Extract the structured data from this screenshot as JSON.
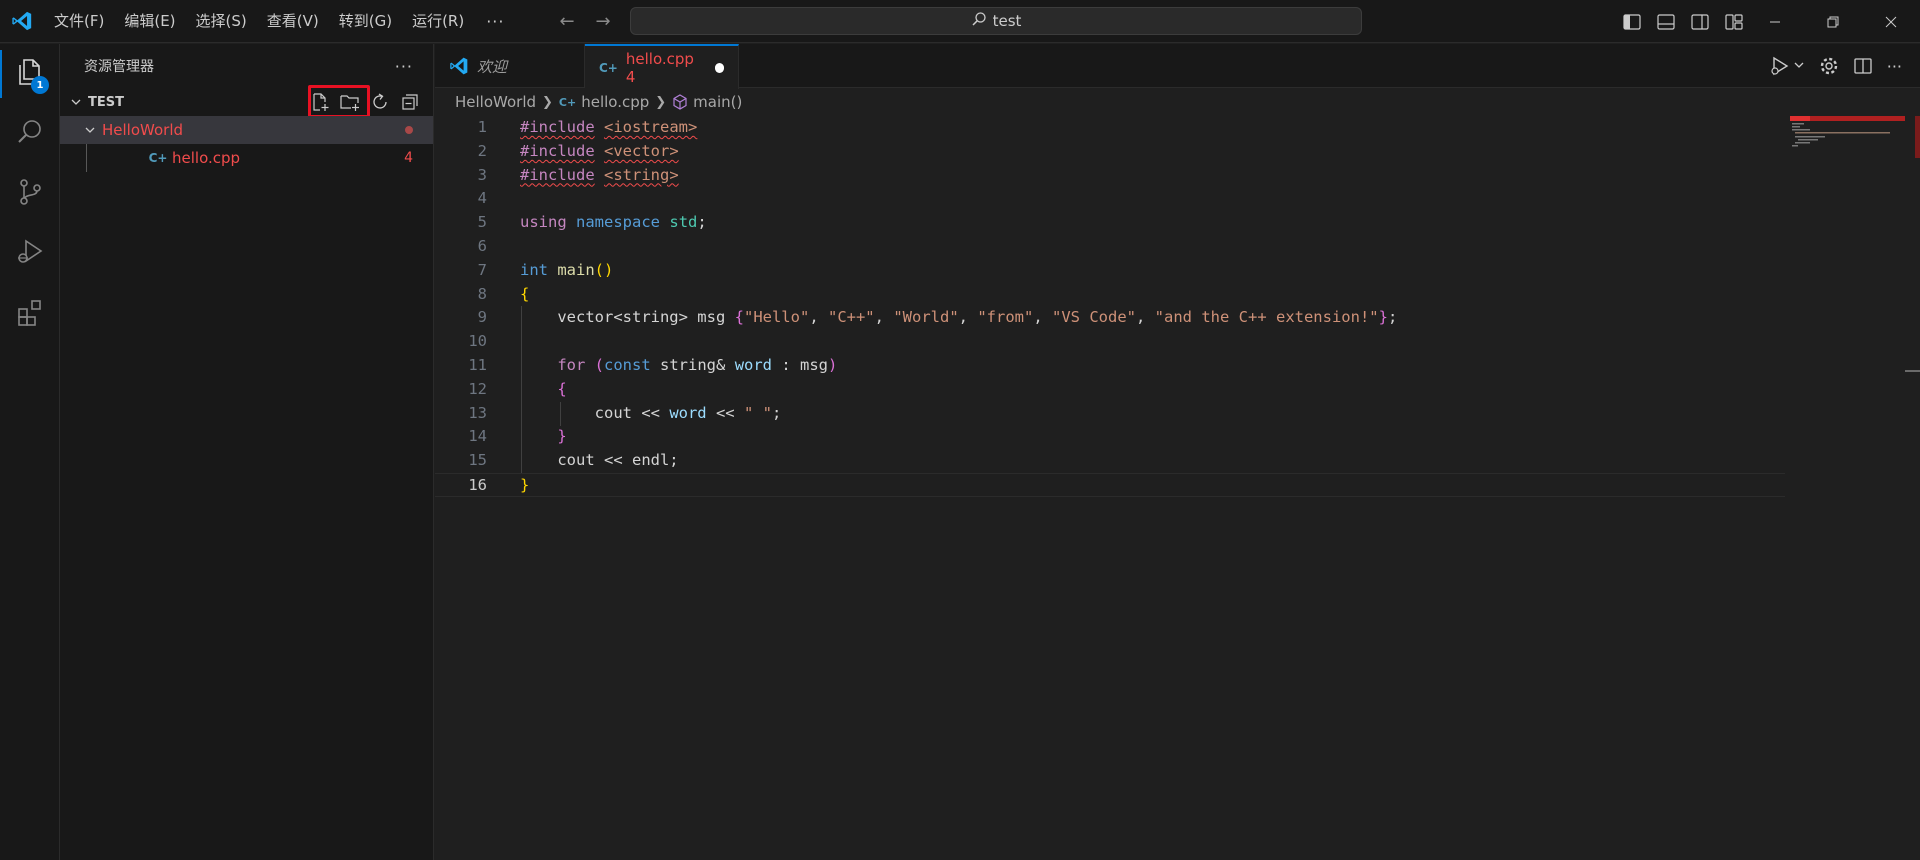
{
  "menu": [
    "文件(F)",
    "编辑(E)",
    "选择(S)",
    "查看(V)",
    "转到(G)",
    "运行(R)"
  ],
  "menu_more": "···",
  "search": {
    "text": "test"
  },
  "explorer": {
    "title": "资源管理器",
    "more": "···",
    "badge": "1",
    "section": "TEST",
    "folder": "HelloWorld",
    "file": "hello.cpp",
    "file_problems": "4",
    "file_icon_glyph": "C+"
  },
  "tabs": {
    "welcome": "欢迎",
    "active": "hello.cpp 4"
  },
  "breadcrumb": {
    "folder": "HelloWorld",
    "file": "hello.cpp",
    "symbol": "main()"
  },
  "code": {
    "line_numbers": [
      "1",
      "2",
      "3",
      "4",
      "5",
      "6",
      "7",
      "8",
      "9",
      "10",
      "11",
      "12",
      "13",
      "14",
      "15",
      "16"
    ],
    "l1_a": "#include",
    "l1_b": "<iostream>",
    "l2_a": "#include",
    "l2_b": "<vector>",
    "l3_a": "#include",
    "l3_b": "<string>",
    "l5_a": "using",
    "l5_b": "namespace",
    "l5_c": "std",
    "l5_d": ";",
    "l7_a": "int",
    "l7_b": "main",
    "l7_c": "()",
    "l8": "{",
    "l9_a": "vector<string> msg ",
    "l9_b": "{",
    "l9_s1": "\"Hello\"",
    "l9_s2": "\"C++\"",
    "l9_s3": "\"World\"",
    "l9_s4": "\"from\"",
    "l9_s5": "\"VS Code\"",
    "l9_s6": "\"and the C++ extension!\"",
    "l9_comma": ", ",
    "l9_c": "}",
    "l9_d": ";",
    "l11_a": "for",
    "l11_b": "(",
    "l11_c": "const",
    "l11_d": " string& ",
    "l11_e": "word",
    "l11_f": " : msg",
    "l11_g": ")",
    "l12": "{",
    "l13_a": "cout << ",
    "l13_b": "word",
    "l13_c": " << ",
    "l13_d": "\" \"",
    "l13_e": ";",
    "l14": "}",
    "l15": "cout << endl;",
    "l16": "}"
  },
  "colors": {
    "accent": "#0078d4",
    "error": "#f14c4c",
    "highlight_box": "#e81123"
  }
}
